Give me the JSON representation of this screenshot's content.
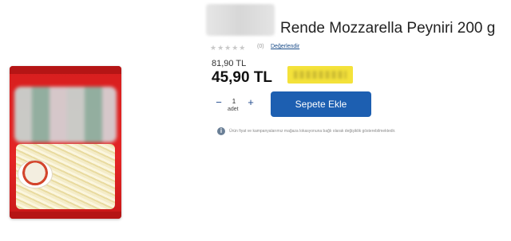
{
  "product": {
    "title": "Rende Mozzarella Peyniri 200 g",
    "image_icon": "product-package-image"
  },
  "rating": {
    "stars": "★★★★★",
    "count": "(0)",
    "link_label": "Değerlendir"
  },
  "price": {
    "old": "81,90 TL",
    "current": "45,90 TL"
  },
  "quantity": {
    "minus": "−",
    "value": "1",
    "plus": "+",
    "unit": "adet"
  },
  "cart": {
    "button_label": "Sepete Ekle"
  },
  "info": {
    "icon": "i",
    "text": "Ürün fiyat ve kampanyalarımız mağaza lokasyonuna bağlı olarak değişiklik gösterebilmektedir."
  },
  "colors": {
    "button": "#1d5fb1",
    "highlight": "#f4e23a",
    "package": "#e42525"
  }
}
